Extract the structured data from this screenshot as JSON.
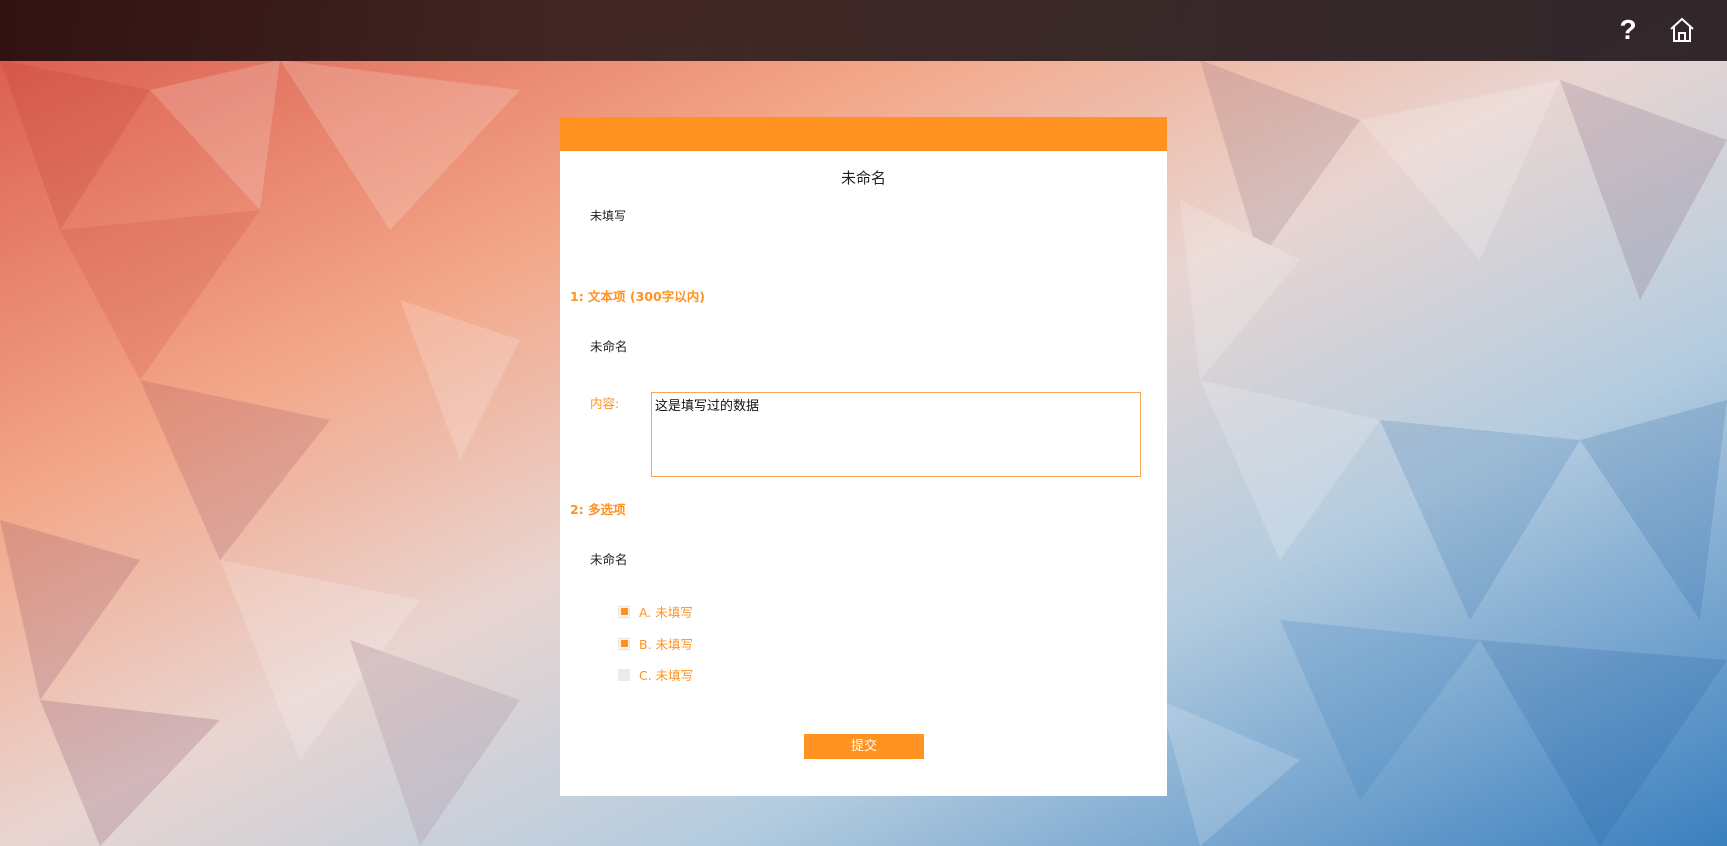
{
  "header": {
    "help_icon": "help-icon",
    "home_icon": "home-icon"
  },
  "form": {
    "accent_color": "#ff9220",
    "title": "未命名",
    "description": "未填写",
    "questions": [
      {
        "label": "1: 文本项 (300字以内)",
        "name": "未命名",
        "content_label": "内容:",
        "value": "这是填写过的数据"
      },
      {
        "label": "2: 多选项",
        "name": "未命名",
        "options": [
          {
            "label": "A. 未填写",
            "checked": true
          },
          {
            "label": "B. 未填写",
            "checked": true
          },
          {
            "label": "C. 未填写",
            "checked": false
          }
        ]
      }
    ],
    "submit_label": "提交"
  }
}
